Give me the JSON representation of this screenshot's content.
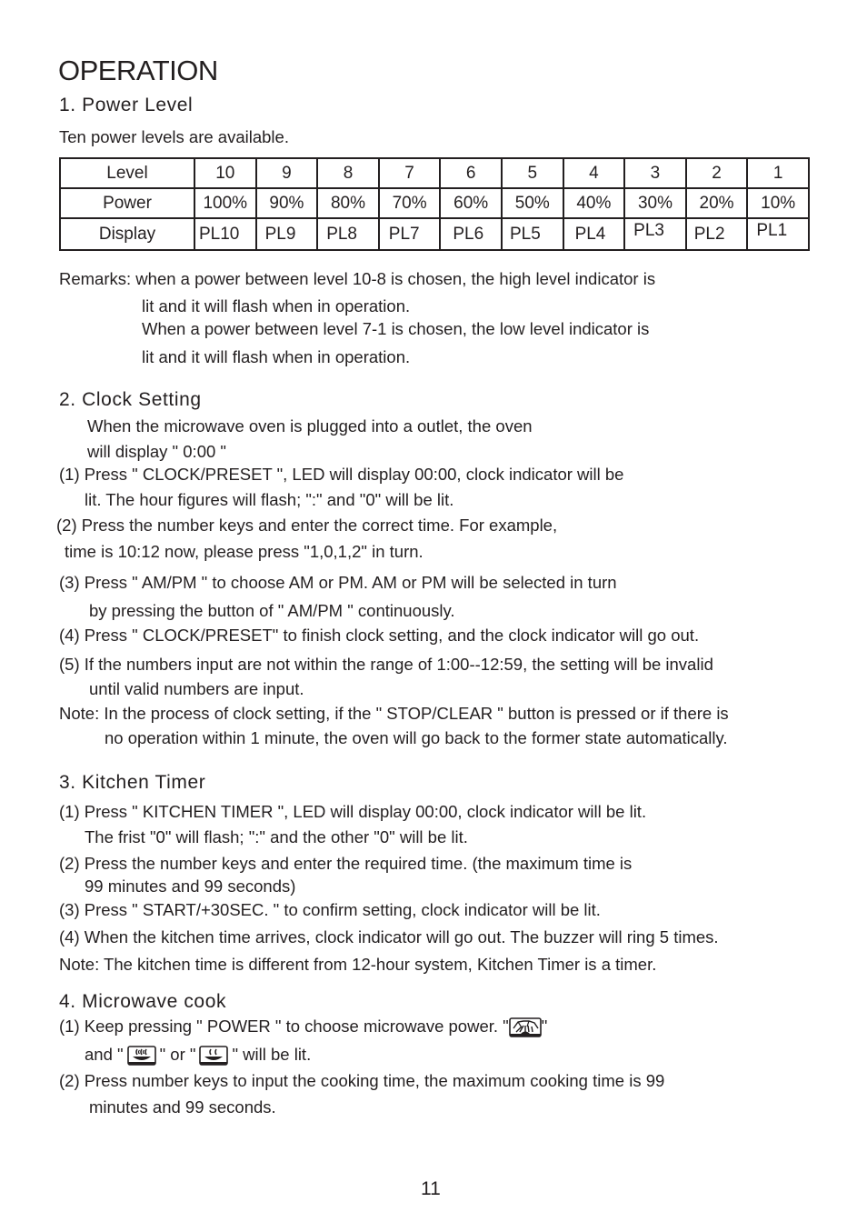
{
  "page": {
    "title": "OPERATION",
    "page_number": "11"
  },
  "power_level": {
    "heading": "1. Power Level",
    "intro": "Ten power levels are available.",
    "table": {
      "row_headers": [
        "Level",
        "Power",
        "Display"
      ],
      "levels": [
        "10",
        "9",
        "8",
        "7",
        "6",
        "5",
        "4",
        "3",
        "2",
        "1"
      ],
      "powers": [
        "100%",
        "90%",
        "80%",
        "70%",
        "60%",
        "50%",
        "40%",
        "30%",
        "20%",
        "10%"
      ],
      "displays": [
        "PL10",
        "PL9",
        "PL8",
        "PL7",
        "PL6",
        "PL5",
        "PL4",
        "PL3",
        "PL2",
        "PL1"
      ]
    },
    "remarks": [
      "Remarks: when a power between level 10-8 is chosen, the high level indicator is",
      "lit and it will flash when in operation.",
      "When a power between level 7-1 is chosen, the low level indicator is",
      "lit and it will flash  when in operation."
    ]
  },
  "clock_setting": {
    "heading": "2. Clock Setting",
    "lines": [
      "When the microwave oven is plugged into a outlet, the oven",
      "will display \" 0:00 \"",
      "(1) Press \" CLOCK/PRESET \", LED will display 00:00, clock indicator will be",
      "lit. The hour figures will flash; \":\" and \"0\" will be lit.",
      "(2) Press the number keys and enter the correct time. For example,",
      "time is 10:12 now, please press  \"1,0,1,2\"  in turn.",
      "(3) Press \" AM/PM \" to choose AM or PM. AM or PM will be selected in turn",
      "by pressing the button of \" AM/PM \" continuously.",
      "(4) Press \" CLOCK/PRESET\"  to finish clock setting, and the clock indicator will go out.",
      "(5) If the numbers input are not within the range of  1:00--12:59, the setting will be invalid",
      "until valid numbers are input.",
      "Note: In the process of clock setting, if the \" STOP/CLEAR \" button is pressed  or if there is",
      "no operation within 1 minute,  the oven will go back to the former state automatically."
    ]
  },
  "kitchen_timer": {
    "heading": "3. Kitchen Timer",
    "lines": [
      "(1) Press \" KITCHEN TIMER \", LED will display 00:00, clock indicator will be lit.",
      "The frist \"0\" will flash; \":\" and  the other \"0\" will be lit.",
      "(2) Press the number keys and enter the required time. (the maximum time is",
      "99 minutes and 99 seconds)",
      "(3) Press \" START/+30SEC. \" to confirm setting, clock indicator will be lit.",
      "(4) When the kitchen time arrives, clock indicator will go out. The buzzer will ring 5 times.",
      "Note: The kitchen time is different from 12-hour system, Kitchen Timer is a timer."
    ]
  },
  "microwave_cook": {
    "heading": "4. Microwave cook",
    "step1_a": "(1) Keep  pressing \" POWER \" to choose microwave power. \"",
    "step1_b": "\"",
    "step1_c": "and \"",
    "step1_d": "\" or \"",
    "step1_e": "\"  will be lit.",
    "step2_a": "(2) Press number keys to input the cooking time, the maximum cooking time is 99",
    "step2_b": "minutes and 99 seconds.",
    "icons": [
      "microwave-indicator-icon",
      "high-level-indicator-icon",
      "low-level-indicator-icon"
    ]
  }
}
